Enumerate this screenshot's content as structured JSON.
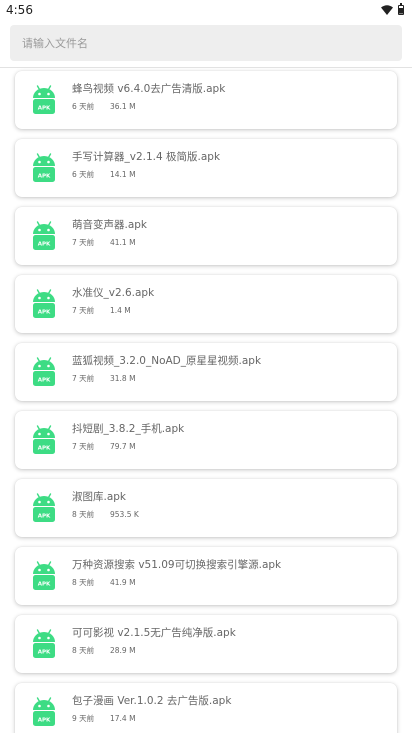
{
  "status_bar": {
    "time": "4:56"
  },
  "search": {
    "placeholder": "请输入文件名"
  },
  "icon": {
    "label": "APK",
    "color": "#3ddc84"
  },
  "files": [
    {
      "name": "蜂鸟视频 v6.4.0去广告清版.apk",
      "time": "6 天前",
      "size": "36.1 M"
    },
    {
      "name": "手写计算器_v2.1.4 极简版.apk",
      "time": "6 天前",
      "size": "14.1 M"
    },
    {
      "name": "萌音变声器.apk",
      "time": "7 天前",
      "size": "41.1 M"
    },
    {
      "name": "水准仪_v2.6.apk",
      "time": "7 天前",
      "size": "1.4 M"
    },
    {
      "name": "蓝狐视频_3.2.0_NoAD_原星星视频.apk",
      "time": "7 天前",
      "size": "31.8 M"
    },
    {
      "name": "抖短剧_3.8.2_手机.apk",
      "time": "7 天前",
      "size": "79.7 M"
    },
    {
      "name": "淑图库.apk",
      "time": "8 天前",
      "size": "953.5 K"
    },
    {
      "name": "万种资源搜索 v51.09可切换搜索引擎源.apk",
      "time": "8 天前",
      "size": "41.9 M"
    },
    {
      "name": "可可影视 v2.1.5无广告纯净版.apk",
      "time": "8 天前",
      "size": "28.9 M"
    },
    {
      "name": "包子漫画 Ver.1.0.2 去广告版.apk",
      "time": "9 天前",
      "size": "17.4 M"
    }
  ]
}
